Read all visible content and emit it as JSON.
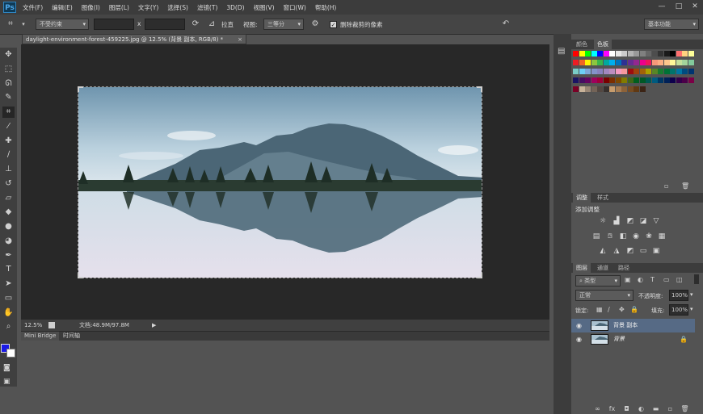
{
  "app": {
    "logo": "Ps"
  },
  "menu": [
    "文件(F)",
    "编辑(E)",
    "图像(I)",
    "图层(L)",
    "文字(Y)",
    "选择(S)",
    "滤镜(T)",
    "3D(D)",
    "视图(V)",
    "窗口(W)",
    "帮助(H)"
  ],
  "window_controls": [
    "—",
    "□",
    "✕"
  ],
  "options_bar": {
    "ratio_value": "不受约束",
    "x_label": "x",
    "straighten_label": "拉直",
    "view_label": "视图:",
    "view_value": "三等分",
    "delete_pixels_label": "删除裁剪的像素",
    "workspace_value": "基本功能"
  },
  "document": {
    "tab_title": "daylight-environment-forest-459225.jpg @ 12.5% (背景 副本, RGB/8) *",
    "tab_close": "×",
    "zoom": "12.5%",
    "doc_info": "文档:48.9M/97.8M"
  },
  "bottom_tabs": [
    "Mini Bridge",
    "时间轴"
  ],
  "swatches_panel": {
    "tabs": [
      "颜色",
      "色板"
    ],
    "colors": [
      [
        "#ff0000",
        "#ffff00",
        "#00ff00",
        "#00ffff",
        "#0000ff",
        "#ff00ff",
        "#ffffff",
        "#e6e6e6",
        "#cccccc",
        "#b3b3b3",
        "#999999",
        "#808080",
        "#666666",
        "#4d4d4d",
        "#333333",
        "#1a1a1a",
        "#000000",
        "#ff6f6f",
        "#ffd27f",
        "#ffff99"
      ],
      [
        "#ed1c24",
        "#f26522",
        "#fff200",
        "#8dc63f",
        "#39b54a",
        "#00a99d",
        "#00aeef",
        "#0072bc",
        "#2e3192",
        "#662d91",
        "#92278f",
        "#ec008c",
        "#ed145b",
        "#f7977a",
        "#fbad82",
        "#fdc68c",
        "#fff799",
        "#c4df9b",
        "#a3d39c",
        "#82ca9c"
      ],
      [
        "#7accc8",
        "#6dcff6",
        "#7ea7d8",
        "#8493ca",
        "#8882be",
        "#a187be",
        "#bc8dbf",
        "#f49ac1",
        "#f5989d",
        "#9e0b0f",
        "#a0410d",
        "#a36209",
        "#aba000",
        "#598527",
        "#1a7b30",
        "#007236",
        "#00746b",
        "#0076a3",
        "#004b80",
        "#003471"
      ],
      [
        "#1b1464",
        "#440e62",
        "#630460",
        "#9e005d",
        "#9e0039",
        "#790000",
        "#7b2e00",
        "#7d4900",
        "#827b00",
        "#406618",
        "#005e20",
        "#005826",
        "#005952",
        "#005b7f",
        "#003663",
        "#002157",
        "#0d004c",
        "#32004b",
        "#4b0049",
        "#7b0046"
      ],
      [
        "#7a0026",
        "#c7b299",
        "#998675",
        "#736357",
        "#534741",
        "#37302d",
        "#c69c6d",
        "#a67c52",
        "#8c6239",
        "#754c24",
        "#603913",
        "#3c2415"
      ]
    ]
  },
  "adjustments_panel": {
    "tabs": [
      "调整",
      "样式"
    ],
    "heading": "添加调整",
    "row1": [
      "brightness-icon",
      "levels-icon",
      "curves-icon",
      "exposure-icon",
      "vibrance-icon"
    ],
    "row2": [
      "hue-sat-icon",
      "color-balance-icon",
      "bw-icon",
      "photo-filter-icon",
      "channel-mixer-icon",
      "color-lookup-icon"
    ],
    "row3": [
      "invert-icon",
      "posterize-icon",
      "threshold-icon",
      "gradient-map-icon",
      "selective-color-icon"
    ]
  },
  "layers_panel": {
    "tabs": [
      "图层",
      "通道",
      "路径"
    ],
    "filter_value": "类型",
    "blend_mode": "正常",
    "opacity_label": "不透明度:",
    "opacity_value": "100%",
    "lock_label": "锁定:",
    "fill_label": "填充:",
    "fill_value": "100%",
    "layers": [
      {
        "name": "背景 副本",
        "selected": true,
        "locked": false
      },
      {
        "name": "背景",
        "selected": false,
        "locked": true
      }
    ]
  }
}
